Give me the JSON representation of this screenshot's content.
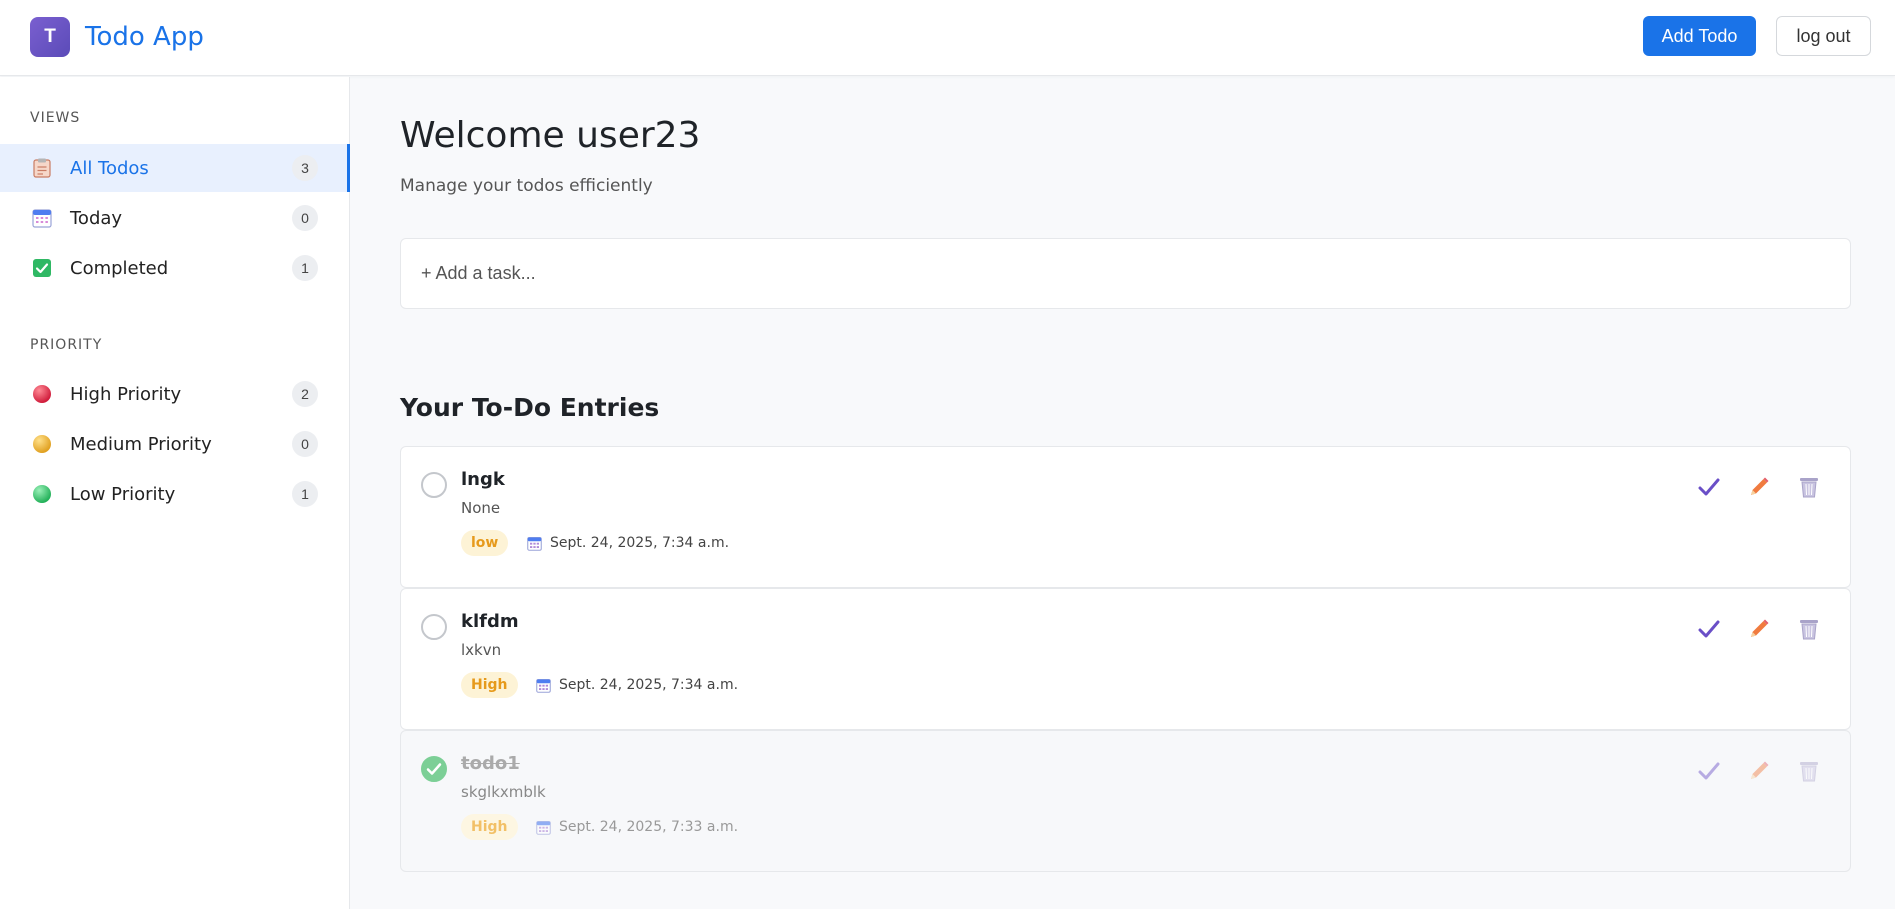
{
  "header": {
    "logo_letter": "T",
    "title": "Todo App",
    "add_button": "Add Todo",
    "logout_button": "log out"
  },
  "sidebar": {
    "views_title": "VIEWS",
    "views": [
      {
        "label": "All Todos",
        "count": "3",
        "icon": "clipboard-icon"
      },
      {
        "label": "Today",
        "count": "0",
        "icon": "calendar-icon"
      },
      {
        "label": "Completed",
        "count": "1",
        "icon": "checkbox-icon"
      }
    ],
    "priority_title": "PRIORITY",
    "priorities": [
      {
        "label": "High Priority",
        "count": "2",
        "icon": "red-dot-icon",
        "color": "#e0324b"
      },
      {
        "label": "Medium Priority",
        "count": "0",
        "icon": "yellow-dot-icon",
        "color": "#f0b429"
      },
      {
        "label": "Low Priority",
        "count": "1",
        "icon": "green-dot-icon",
        "color": "#35c46a"
      }
    ]
  },
  "main": {
    "welcome": "Welcome user23",
    "subtitle": "Manage your todos efficiently",
    "add_task_placeholder": "+ Add a task...",
    "list_title": "Your To-Do Entries",
    "todos": [
      {
        "title": "lngk",
        "description": "None",
        "priority": "low",
        "date": "Sept. 24, 2025, 7:34 a.m.",
        "completed": false
      },
      {
        "title": "klfdm",
        "description": "lxkvn",
        "priority": "High",
        "date": "Sept. 24, 2025, 7:34 a.m.",
        "completed": false
      },
      {
        "title": "todo1",
        "description": "skglkxmblk",
        "priority": "High",
        "date": "Sept. 24, 2025, 7:33 a.m.",
        "completed": true
      }
    ]
  },
  "colors": {
    "accent": "#1a73e8",
    "check_action": "#6a4fc7",
    "edit_action": "#f07b3f",
    "delete_action": "#a9a3c9"
  }
}
